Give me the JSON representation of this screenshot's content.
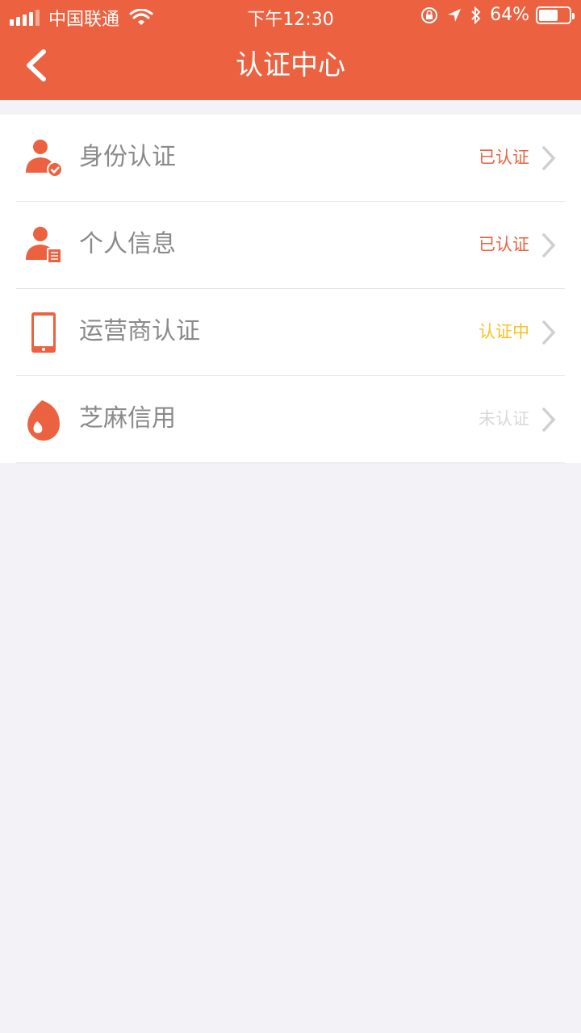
{
  "status_bar": {
    "carrier": "中国联通",
    "time": "下午12:30",
    "battery_percent": "64%",
    "battery_level": 0.64
  },
  "nav": {
    "title": "认证中心",
    "back_icon": "chevron-left-icon"
  },
  "items": [
    {
      "label": "身份认证",
      "status": "已认证",
      "status_color": "#ec6240",
      "icon": "user-verified-icon"
    },
    {
      "label": "个人信息",
      "status": "已认证",
      "status_color": "#ec6240",
      "icon": "user-document-icon"
    },
    {
      "label": "运营商认证",
      "status": "认证中",
      "status_color": "#f5c323",
      "icon": "phone-icon"
    },
    {
      "label": "芝麻信用",
      "status": "未认证",
      "status_color": "#d8d8d8",
      "icon": "sesame-credit-icon"
    }
  ],
  "colors": {
    "brand": "#ec6240",
    "background": "#f2f2f7"
  }
}
